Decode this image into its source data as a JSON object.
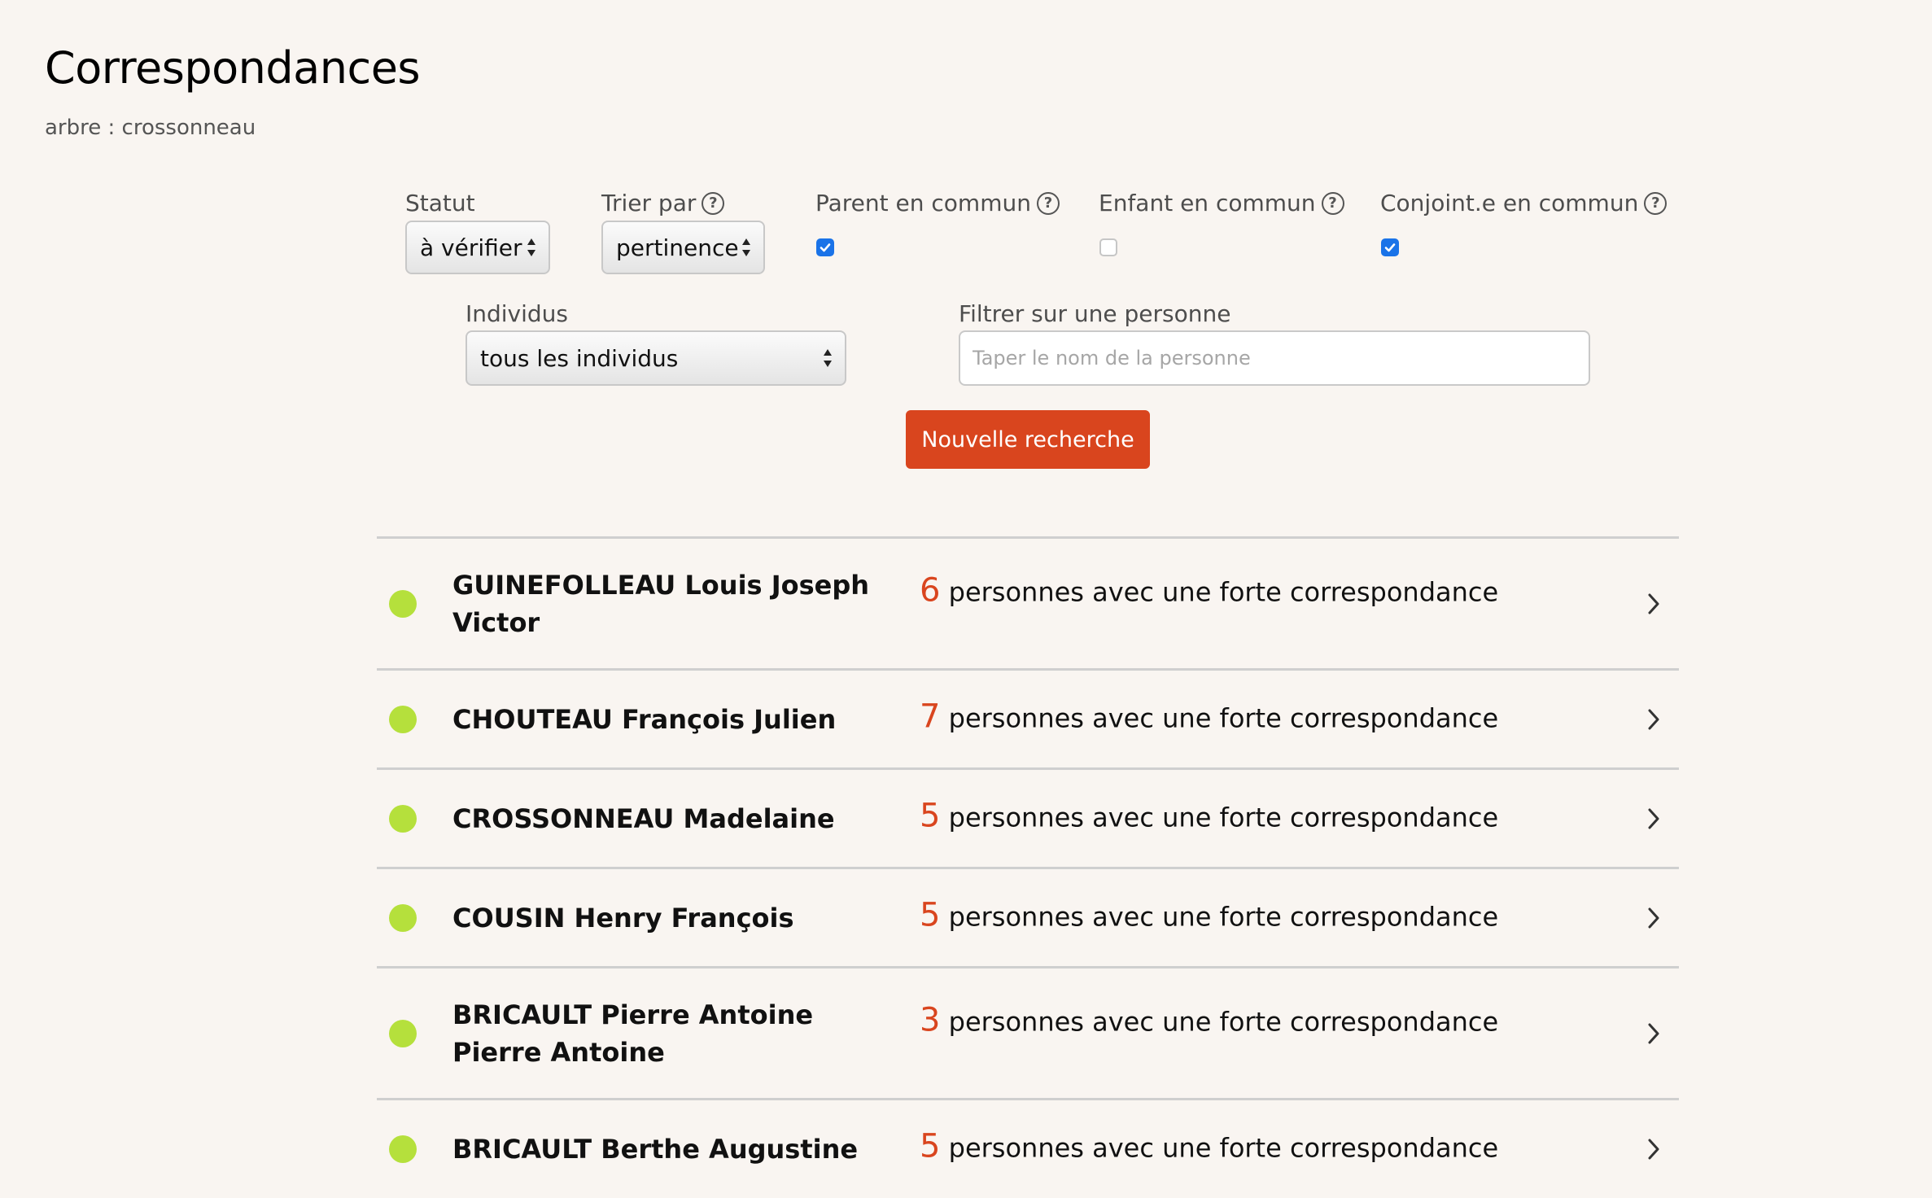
{
  "page": {
    "title": "Correspondances",
    "tree_label": "arbre : crossonneau"
  },
  "filters": {
    "statut": {
      "label": "Statut",
      "value": "à vérifier"
    },
    "trier_par": {
      "label": "Trier par",
      "value": "pertinence"
    },
    "parent_commun": {
      "label": "Parent en commun",
      "checked": true
    },
    "enfant_commun": {
      "label": "Enfant en commun",
      "checked": false
    },
    "conjoint_commun": {
      "label": "Conjoint.e en commun",
      "checked": true
    },
    "individus": {
      "label": "Individus",
      "value": "tous les individus"
    },
    "filtrer_personne": {
      "label": "Filtrer sur une personne",
      "placeholder": "Taper le nom de la personne",
      "value": ""
    },
    "search_button": "Nouvelle recherche"
  },
  "results": [
    {
      "name": "GUINEFOLLEAU Louis Joseph Victor",
      "count": "6",
      "text": "personnes avec une forte correspondance"
    },
    {
      "name": "CHOUTEAU François Julien",
      "count": "7",
      "text": "personnes avec une forte correspondance"
    },
    {
      "name": "CROSSONNEAU Madelaine",
      "count": "5",
      "text": "personnes avec une forte correspondance"
    },
    {
      "name": "COUSIN Henry François",
      "count": "5",
      "text": "personnes avec une forte correspondance"
    },
    {
      "name": "BRICAULT Pierre Antoine Pierre Antoine",
      "count": "3",
      "text": "personnes avec une forte correspondance"
    },
    {
      "name": "BRICAULT Berthe Augustine",
      "count": "5",
      "text": "personnes avec une forte correspondance"
    }
  ],
  "colors": {
    "accent": "#d9451e",
    "status_dot": "#b5e03c",
    "checkbox": "#1a73e8",
    "background": "#f9f5f1"
  },
  "icons": {
    "help": "question-circle-icon",
    "select": "up-down-arrows-icon",
    "row": "chevron-right-icon",
    "checkmark": "checkmark-icon"
  }
}
